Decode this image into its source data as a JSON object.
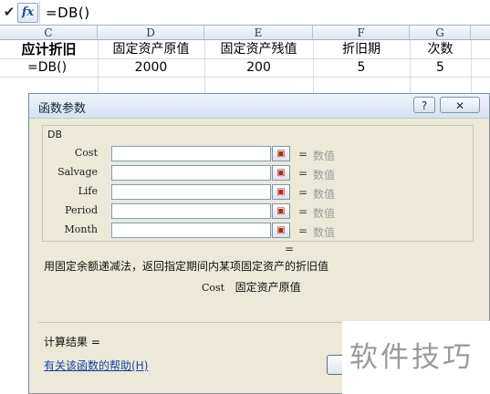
{
  "formula_bar": {
    "check_icon": "check-icon",
    "fx_label": "fx",
    "formula": "=DB()"
  },
  "columns": [
    "C",
    "D",
    "E",
    "F",
    "G"
  ],
  "header_row": [
    "应计折旧",
    "固定资产原值",
    "固定资产残值",
    "折旧期",
    "次数"
  ],
  "data_row": [
    "=DB()",
    "2000",
    "200",
    "5",
    "5"
  ],
  "dialog": {
    "title": "函数参数",
    "help_btn": "?",
    "close_btn": "✕",
    "function_name": "DB",
    "args": [
      {
        "label": "Cost",
        "hint": "数值"
      },
      {
        "label": "Salvage",
        "hint": "数值"
      },
      {
        "label": "Life",
        "hint": "数值"
      },
      {
        "label": "Period",
        "hint": "数值"
      },
      {
        "label": "Month",
        "hint": "数值"
      }
    ],
    "equals": "=",
    "description": "用固定余额递减法，返回指定期间内某项固定资产的折旧值",
    "arg_description_name": "Cost",
    "arg_description_text": "固定资产原值",
    "result_label": "计算结果 =",
    "help_link": "有关该函数的帮助(H)"
  },
  "watermark": "软件技巧"
}
